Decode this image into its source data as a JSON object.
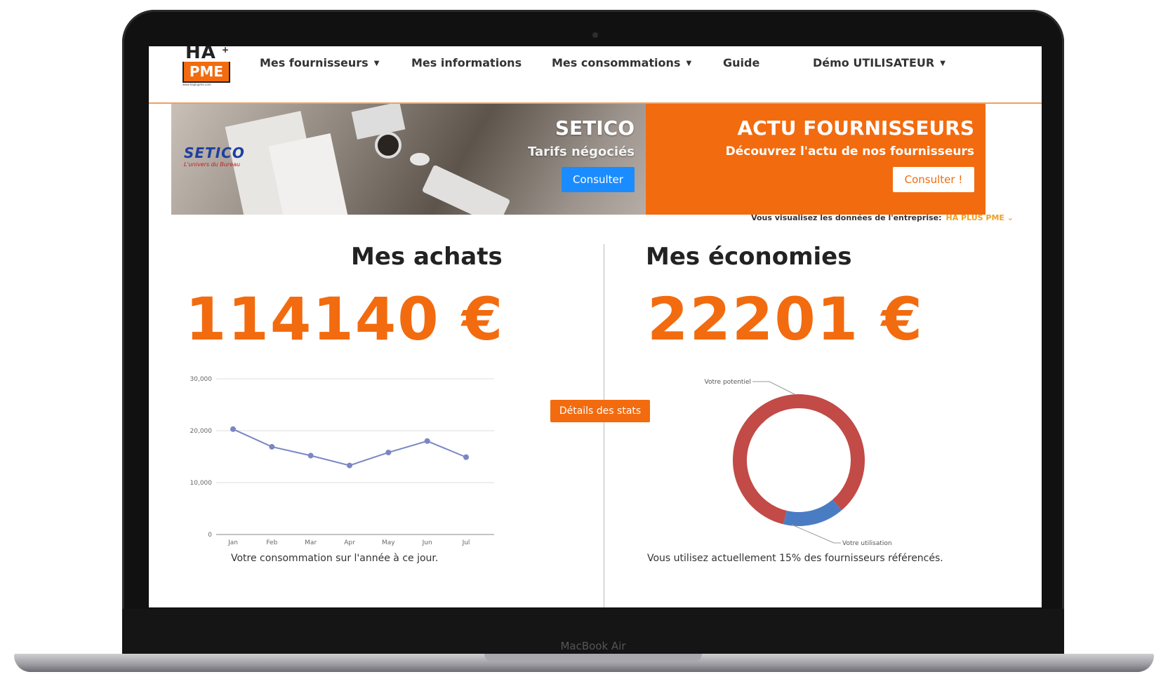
{
  "device": {
    "label": "MacBook Air"
  },
  "navbar": {
    "logo_top": "HA",
    "logo_plus": "+",
    "logo_box": "PME",
    "logo_url": "www.haplupme.com",
    "items": [
      {
        "label": "Mes fournisseurs",
        "dropdown": true
      },
      {
        "label": "Mes informations",
        "dropdown": false
      },
      {
        "label": "Mes consommations",
        "dropdown": true
      },
      {
        "label": "Guide",
        "dropdown": false
      },
      {
        "label": "Démo UTILISATEUR",
        "dropdown": true
      }
    ]
  },
  "banner": {
    "supplier_logo": "SETICO",
    "supplier_tagline": "L'univers du Bureau",
    "supplier_title": "SETICO",
    "supplier_subtitle": "Tarifs négociés",
    "supplier_button": "Consulter",
    "actu_title": "ACTU FOURNISSEURS",
    "actu_subtitle": "Découvrez l'actu de nos fournisseurs",
    "actu_button": "Consulter !"
  },
  "company": {
    "label": "Vous visualisez les données de l'entreprise:",
    "name": "HA PLUS PME",
    "chevron": "⌄"
  },
  "achats": {
    "title": "Mes achats",
    "amount": "114140 €",
    "caption": "Votre consommation sur l'année à ce jour."
  },
  "economies": {
    "title": "Mes économies",
    "amount": "22201 €",
    "caption": "Vous utilisez actuellement 15% des fournisseurs référencés."
  },
  "stats_button": "Détails des stats",
  "colors": {
    "accent": "#f26b0f",
    "blue_button": "#1a8cff",
    "line": "#7b86c4",
    "donut_potential": "#c24a47",
    "donut_usage": "#4a7cc4"
  },
  "chart_data": [
    {
      "type": "line",
      "categories": [
        "Jan",
        "Feb",
        "Mar",
        "Apr",
        "May",
        "Jun",
        "Jul"
      ],
      "series": [
        {
          "values": [
            20300,
            16900,
            15200,
            13300,
            15800,
            18000,
            14900
          ]
        }
      ],
      "y_ticks": [
        "0",
        "10,000",
        "20,000",
        "30,000"
      ],
      "ylim": [
        0,
        30000
      ],
      "grid": true
    },
    {
      "type": "pie",
      "labels": [
        "Votre potentiel",
        "Votre utilisation"
      ],
      "values": [
        85,
        15
      ],
      "donut": true
    }
  ]
}
